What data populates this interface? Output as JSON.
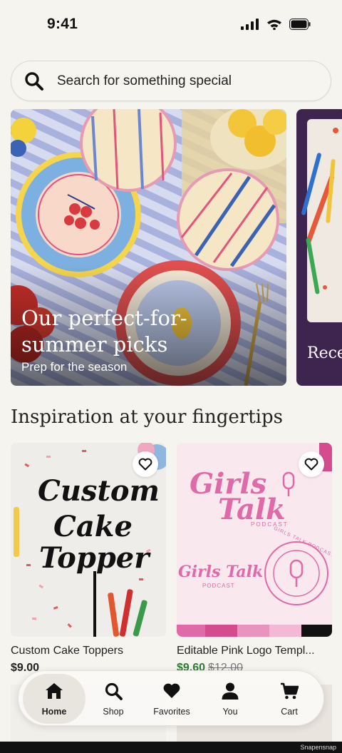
{
  "status": {
    "time": "9:41"
  },
  "search": {
    "placeholder": "Search for something special"
  },
  "hero": {
    "title": "Our perfect-for-summer picks",
    "subtitle": "Prep for the season",
    "next_title_partial": "Rece"
  },
  "section": {
    "title": "Inspiration at your fingertips"
  },
  "cards": [
    {
      "title": "Custom Cake Toppers",
      "price": "$9.00",
      "image_text": [
        "Custom",
        "Cake",
        "Topper"
      ]
    },
    {
      "title": "Editable Pink Logo Templ...",
      "price": "$9.60",
      "original_price": "$12.00",
      "image_text": [
        "Girls",
        "Talk",
        "PODCAST",
        "Girls Talk",
        "PODCAST",
        "GIRLS TALK PODCAST"
      ]
    }
  ],
  "nav": {
    "items": [
      {
        "label": "Home",
        "icon": "home-icon",
        "active": true
      },
      {
        "label": "Shop",
        "icon": "search-icon"
      },
      {
        "label": "Favorites",
        "icon": "heart-icon"
      },
      {
        "label": "You",
        "icon": "person-icon"
      },
      {
        "label": "Cart",
        "icon": "cart-icon"
      }
    ]
  },
  "watermark": "Snapensnap",
  "colors": {
    "background": "#f6f4ef",
    "sale_green": "#2e7d32",
    "accent_pink": "#e06aa8"
  }
}
